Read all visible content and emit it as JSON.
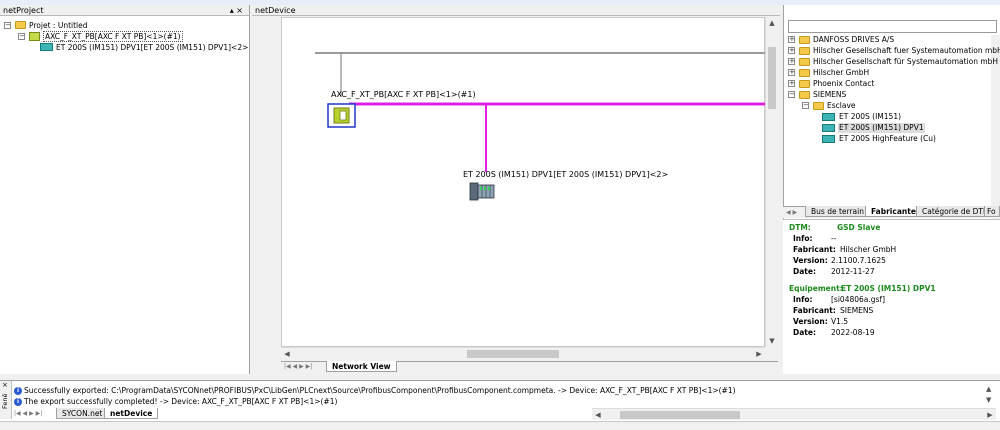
{
  "panels": {
    "left_title": "netProject",
    "left_controls": "▴ ×",
    "center_title": "netDevice"
  },
  "tree": {
    "root_label": "Projet : Untitled",
    "master_label": "AXC_F_XT_PB[AXC F XT PB]<1>(#1)",
    "slave_label": "ET 200S (IM151) DPV1[ET 200S (IM151) DPV1]<2>"
  },
  "network": {
    "master_label": "AXC_F_XT_PB[AXC F XT PB]<1>(#1)",
    "slave_label": "ET 200S (IM151) DPV1[ET 200S (IM151) DPV1]<2>",
    "tab_label": "Network View",
    "bus_color": "#e020e0"
  },
  "catalog": {
    "items": [
      {
        "label": "DANFOSS DRIVES A/S",
        "expanded": false
      },
      {
        "label": "Hilscher Gesellschaft fuer Systemautomation mbH",
        "expanded": false
      },
      {
        "label": "Hilscher Gesellschaft für Systemautomation mbH",
        "expanded": false
      },
      {
        "label": "Hilscher GmbH",
        "expanded": false
      },
      {
        "label": "Phoenix Contact",
        "expanded": false
      },
      {
        "label": "SIEMENS",
        "expanded": true
      }
    ],
    "subfolder": "Esclave",
    "devices": [
      "ET 200S (IM151)",
      "ET 200S (IM151) DPV1",
      "ET 200S HighFeature (Cu)"
    ],
    "selected_device": "ET 200S (IM151) DPV1",
    "tabs": [
      "Bus de terrain",
      "Fabricante",
      "Catégorie de DTM",
      "Fo"
    ]
  },
  "info": {
    "dtm_key": "DTM:",
    "dtm_value": "GSD Slave",
    "dtm_rows": [
      {
        "key": "Info:",
        "value": "--"
      },
      {
        "key": "Fabricant:",
        "value": "Hilscher GmbH"
      },
      {
        "key": "Version:",
        "value": "2.1100.7.1625"
      },
      {
        "key": "Date:",
        "value": "2012-11-27"
      }
    ],
    "equip_key": "Equipement:",
    "equip_value": "ET 200S (IM151) DPV1",
    "equip_rows": [
      {
        "key": "Info:",
        "value": "[si04806a.gsf]"
      },
      {
        "key": "Fabricant:",
        "value": "SIEMENS"
      },
      {
        "key": "Version:",
        "value": "V1.5"
      },
      {
        "key": "Date:",
        "value": "2022-08-19"
      }
    ]
  },
  "output": {
    "side_label": "Fenê",
    "messages": [
      "Successfully exported: C:\\ProgramData\\SYCONnet\\PROFIBUS\\PxC\\LibGen\\PLCnext\\Source\\ProfibusComponent\\ProfibusComponent.compmeta. -> Device: AXC_F_XT_PB[AXC F XT PB]<1>(#1)",
      "The export successfully completed! -> Device: AXC_F_XT_PB[AXC F XT PB]<1>(#1)"
    ],
    "tabs": [
      "SYCON.net",
      "netDevice"
    ]
  }
}
